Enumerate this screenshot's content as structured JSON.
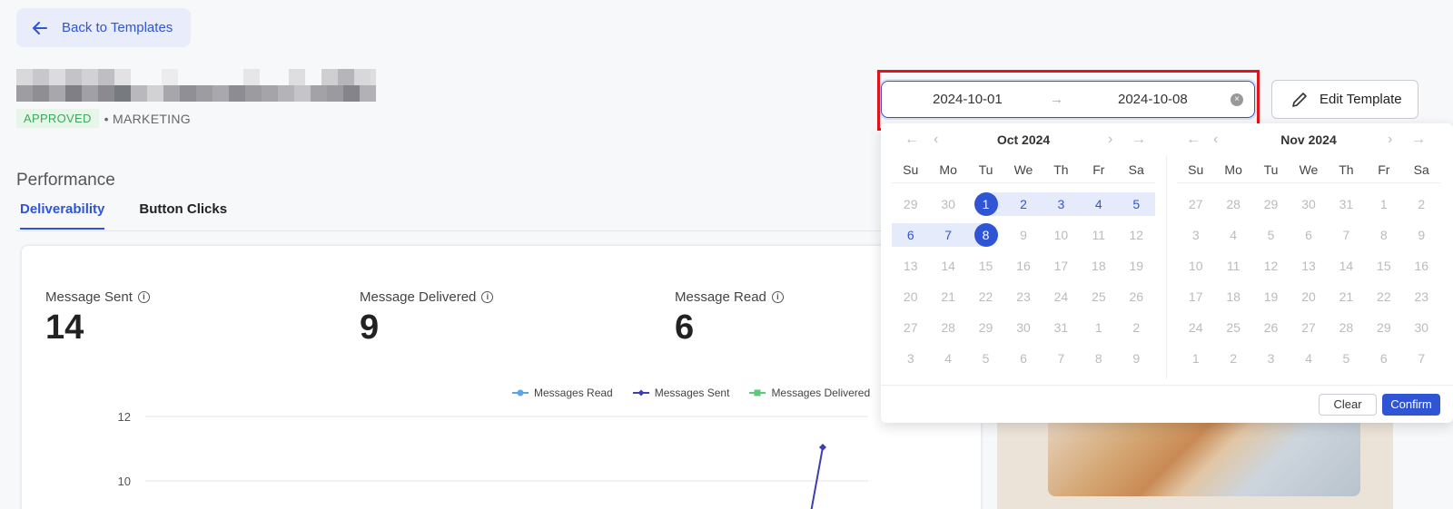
{
  "back_button": {
    "label": "Back to Templates"
  },
  "template": {
    "status": "APPROVED",
    "category": "• MARKETING"
  },
  "performance": {
    "title": "Performance",
    "tabs": [
      {
        "label": "Deliverability",
        "active": true
      },
      {
        "label": "Button Clicks",
        "active": false
      }
    ],
    "metrics": [
      {
        "label": "Message Sent",
        "value": "14"
      },
      {
        "label": "Message Delivered",
        "value": "9"
      },
      {
        "label": "Message Read",
        "value": "6"
      }
    ],
    "info_glyph": "i"
  },
  "chart_data": {
    "type": "line",
    "series": [
      {
        "name": "Messages Read",
        "color": "#5aa5e6"
      },
      {
        "name": "Messages Sent",
        "color": "#3f3fb0"
      },
      {
        "name": "Messages Delivered",
        "color": "#5cc97a"
      }
    ],
    "yticks": [
      "12",
      "10"
    ],
    "visible_points": [
      {
        "series": "Messages Sent",
        "y": 11
      }
    ]
  },
  "date_range": {
    "start": "2024-10-01",
    "end": "2024-10-08",
    "arrow": "→",
    "clear_glyph": "×"
  },
  "edit_button": {
    "label": "Edit Template"
  },
  "picker": {
    "weekdays": [
      "Su",
      "Mo",
      "Tu",
      "We",
      "Th",
      "Fr",
      "Sa"
    ],
    "nav": {
      "prev_year": "←",
      "prev_month": "‹",
      "next_month": "›",
      "next_year": "→"
    },
    "calendars": [
      {
        "title": "Oct 2024",
        "weeks": [
          [
            "29",
            "30",
            "1",
            "2",
            "3",
            "4",
            "5"
          ],
          [
            "6",
            "7",
            "8",
            "9",
            "10",
            "11",
            "12"
          ],
          [
            "13",
            "14",
            "15",
            "16",
            "17",
            "18",
            "19"
          ],
          [
            "20",
            "21",
            "22",
            "23",
            "24",
            "25",
            "26"
          ],
          [
            "27",
            "28",
            "29",
            "30",
            "31",
            "1",
            "2"
          ],
          [
            "3",
            "4",
            "5",
            "6",
            "7",
            "8",
            "9"
          ]
        ]
      },
      {
        "title": "Nov 2024",
        "weeks": [
          [
            "27",
            "28",
            "29",
            "30",
            "31",
            "1",
            "2"
          ],
          [
            "3",
            "4",
            "5",
            "6",
            "7",
            "8",
            "9"
          ],
          [
            "10",
            "11",
            "12",
            "13",
            "14",
            "15",
            "16"
          ],
          [
            "17",
            "18",
            "19",
            "20",
            "21",
            "22",
            "23"
          ],
          [
            "24",
            "25",
            "26",
            "27",
            "28",
            "29",
            "30"
          ],
          [
            "1",
            "2",
            "3",
            "4",
            "5",
            "6",
            "7"
          ]
        ]
      }
    ],
    "clear_label": "Clear",
    "confirm_label": "Confirm"
  }
}
